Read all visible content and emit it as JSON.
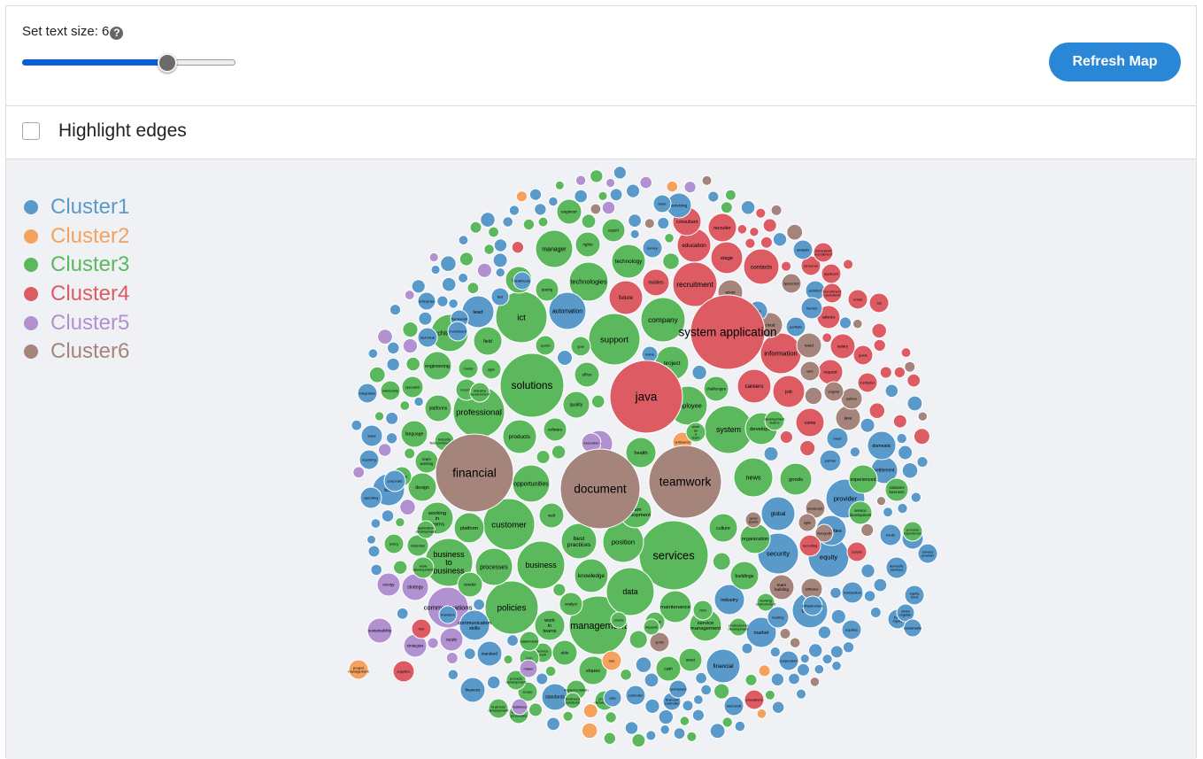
{
  "controls": {
    "text_size_label": "Set text size: 6",
    "help_icon": "question-circle-icon",
    "slider_value": 6,
    "slider_fraction": 0.68,
    "refresh_label": "Refresh Map",
    "highlight_edges_label": "Highlight edges",
    "highlight_edges_checked": false
  },
  "colors": {
    "accent": "#2a86d6",
    "slider_fill": "#0a5fd6",
    "map_background": "#f0f1f5"
  },
  "legend": [
    {
      "label": "Cluster1",
      "color": "#5a9acb"
    },
    {
      "label": "Cluster2",
      "color": "#f5a25e"
    },
    {
      "label": "Cluster3",
      "color": "#5cb85c"
    },
    {
      "label": "Cluster4",
      "color": "#dd5c64"
    },
    {
      "label": "Cluster5",
      "color": "#b191d0"
    },
    {
      "label": "Cluster6",
      "color": "#a5847b"
    }
  ],
  "bubbles": [
    {
      "label": "application",
      "cluster": 4
    },
    {
      "label": "teams",
      "cluster": 3
    },
    {
      "label": "developments",
      "cluster": 3
    },
    {
      "label": "collaboration",
      "cluster": 3
    },
    {
      "label": "development",
      "cluster": 3
    },
    {
      "label": "services",
      "cluster": 3
    },
    {
      "label": "solutions",
      "cluster": 3
    },
    {
      "label": "professional",
      "cluster": 3
    },
    {
      "label": "business to business",
      "cluster": 3
    },
    {
      "label": "business",
      "cluster": 3
    },
    {
      "label": "customer",
      "cluster": 3
    },
    {
      "label": "policies",
      "cluster": 3
    },
    {
      "label": "management",
      "cluster": 3
    },
    {
      "label": "data",
      "cluster": 3
    },
    {
      "label": "ict",
      "cluster": 3
    },
    {
      "label": "support",
      "cluster": 3
    },
    {
      "label": "company",
      "cluster": 3
    },
    {
      "label": "system",
      "cluster": 3
    },
    {
      "label": "recruitment",
      "cluster": 4
    },
    {
      "label": "information",
      "cluster": 4
    },
    {
      "label": "news",
      "cluster": 3
    },
    {
      "label": "opportunities",
      "cluster": 3
    },
    {
      "label": "position",
      "cluster": 3
    },
    {
      "label": "employee",
      "cluster": 3
    },
    {
      "label": "project",
      "cluster": 3
    },
    {
      "label": "careers",
      "cluster": 4
    },
    {
      "label": "job",
      "cluster": 4
    },
    {
      "label": "security",
      "cluster": 1
    },
    {
      "label": "equity",
      "cluster": 1
    },
    {
      "label": "global",
      "cluster": 1
    },
    {
      "label": "provider",
      "cluster": 1
    },
    {
      "label": "products",
      "cluster": 3
    },
    {
      "label": "health",
      "cluster": 3
    },
    {
      "label": "processes",
      "cluster": 3
    },
    {
      "label": "knowledge",
      "cluster": 3
    },
    {
      "label": "best practices",
      "cluster": 3
    },
    {
      "label": "team development",
      "cluster": 3
    },
    {
      "label": "quality",
      "cluster": 3
    },
    {
      "label": "contacts",
      "cluster": 4
    },
    {
      "label": "education",
      "cluster": 4
    },
    {
      "label": "manager",
      "cluster": 3
    },
    {
      "label": "technologies",
      "cluster": 3
    },
    {
      "label": "technology",
      "cluster": 3
    },
    {
      "label": "automation",
      "cluster": 1
    },
    {
      "label": "field",
      "cluster": 3
    },
    {
      "label": "lead",
      "cluster": 1
    },
    {
      "label": "architectures",
      "cluster": 3
    },
    {
      "label": "tool",
      "cluster": 1
    },
    {
      "label": "design",
      "cluster": 3
    },
    {
      "label": "working in teams",
      "cluster": 3
    },
    {
      "label": "platform",
      "cluster": 3
    },
    {
      "label": "well",
      "cluster": 3
    },
    {
      "label": "work in teams",
      "cluster": 3
    },
    {
      "label": "communications",
      "cluster": 5
    },
    {
      "label": "industry",
      "cluster": 1
    },
    {
      "label": "culture",
      "cluster": 3
    },
    {
      "label": "organization",
      "cluster": 3
    },
    {
      "label": "buildings",
      "cluster": 3
    },
    {
      "label": "maintenance",
      "cluster": 3
    },
    {
      "label": "service management",
      "cluster": 3
    },
    {
      "label": "goods",
      "cluster": 3
    },
    {
      "label": "developer",
      "cluster": 3
    },
    {
      "label": "capital",
      "cluster": 1
    },
    {
      "label": "market",
      "cluster": 1
    },
    {
      "label": "financial",
      "cluster": 1
    },
    {
      "label": "future",
      "cluster": 4
    },
    {
      "label": "stage",
      "cluster": 4
    },
    {
      "label": "recruiter",
      "cluster": 4
    },
    {
      "label": "securities",
      "cluster": 1
    },
    {
      "label": "settlement",
      "cluster": 1
    },
    {
      "label": "domestic",
      "cluster": 1
    },
    {
      "label": "strategy",
      "cluster": 5
    },
    {
      "label": "coms",
      "cluster": 4
    },
    {
      "label": "challenges",
      "cluster": 3
    },
    {
      "label": "office",
      "cluster": 3
    },
    {
      "label": "software",
      "cluster": 3
    },
    {
      "label": "platforms",
      "cluster": 3
    },
    {
      "label": "language",
      "cluster": 3
    },
    {
      "label": "engineering",
      "cluster": 3
    },
    {
      "label": "person",
      "cluster": 3
    },
    {
      "label": "testing",
      "cluster": 3
    },
    {
      "label": "rights",
      "cluster": 3
    },
    {
      "label": "expert",
      "cluster": 3
    },
    {
      "label": "engineer",
      "cluster": 3
    },
    {
      "label": "mobiles",
      "cluster": 4
    },
    {
      "label": "consultant",
      "cluster": 4
    },
    {
      "label": "azure",
      "cluster": 6
    },
    {
      "label": "cloud",
      "cluster": 6
    },
    {
      "label": "salaries",
      "cluster": 4
    },
    {
      "label": "salary",
      "cluster": 4
    },
    {
      "label": "request",
      "cluster": 4
    },
    {
      "label": "react",
      "cluster": 6
    },
    {
      "label": "java",
      "cluster": 6
    },
    {
      "label": "team building",
      "cluster": 6
    },
    {
      "label": "attitudes",
      "cluster": 6
    },
    {
      "label": "shares",
      "cluster": 3
    },
    {
      "label": "able",
      "cluster": 3
    },
    {
      "label": "cash",
      "cluster": 3
    },
    {
      "label": "asset",
      "cluster": 3
    },
    {
      "label": "standards",
      "cluster": 1
    },
    {
      "label": "finances",
      "cluster": 1
    },
    {
      "label": "standard",
      "cluster": 1
    },
    {
      "label": "communication skills",
      "cluster": 1
    },
    {
      "label": "vendor",
      "cluster": 3
    },
    {
      "label": "analyst",
      "cluster": 3
    },
    {
      "label": "sustainability",
      "cluster": 5
    },
    {
      "label": "energy",
      "cluster": 5
    },
    {
      "label": "supply",
      "cluster": 5
    },
    {
      "label": "strategies",
      "cluster": 5
    },
    {
      "label": "project management",
      "cluster": 2
    },
    {
      "label": "doe",
      "cluster": 2
    },
    {
      "label": "sports",
      "cluster": 3
    },
    {
      "label": "goal",
      "cluster": 3
    },
    {
      "label": "agile",
      "cluster": 3
    },
    {
      "label": "model",
      "cluster": 3
    },
    {
      "label": "records",
      "cluster": 3
    },
    {
      "label": "specialist",
      "cluster": 3
    },
    {
      "label": "ownership",
      "cluster": 3
    },
    {
      "label": "team working",
      "cluster": 3
    },
    {
      "label": "materials",
      "cluster": 3
    },
    {
      "label": "policy",
      "cluster": 3
    },
    {
      "label": "leading",
      "cluster": 1
    },
    {
      "label": "funds",
      "cluster": 1
    },
    {
      "label": "bonds",
      "cluster": 1
    },
    {
      "label": "transaction",
      "cluster": 1
    },
    {
      "label": "head",
      "cluster": 1
    },
    {
      "label": "partner",
      "cluster": 1
    },
    {
      "label": "cooperation",
      "cluster": 1
    },
    {
      "label": "operating",
      "cluster": 1
    },
    {
      "label": "sales",
      "cluster": 1
    },
    {
      "label": "reporting",
      "cluster": 1
    },
    {
      "label": "integration",
      "cluster": 1
    },
    {
      "label": "technical",
      "cluster": 1
    },
    {
      "label": "enterprise",
      "cluster": 1
    },
    {
      "label": "framework",
      "cluster": 1
    },
    {
      "label": "user",
      "cluster": 1
    },
    {
      "label": "typescript",
      "cluster": 6
    },
    {
      "label": "personal",
      "cluster": 4
    },
    {
      "label": "applicant",
      "cluster": 4
    },
    {
      "label": "email",
      "cluster": 4
    },
    {
      "label": "guide",
      "cluster": 4
    },
    {
      "label": "institution",
      "cluster": 4
    },
    {
      "label": "sql",
      "cluster": 4
    },
    {
      "label": "python",
      "cluster": 6
    },
    {
      "label": "angular",
      "cluster": 6
    },
    {
      "label": "scripts",
      "cluster": 4
    },
    {
      "label": "mongodb",
      "cluster": 6
    },
    {
      "label": "javascript",
      "cluster": 6
    },
    {
      "label": "agile",
      "cluster": 6
    },
    {
      "label": "web",
      "cluster": 6
    },
    {
      "label": "good sports",
      "cluster": 6
    },
    {
      "label": "sprits",
      "cluster": 6
    },
    {
      "label": "interest",
      "cluster": 3
    },
    {
      "label": "html",
      "cluster": 3
    },
    {
      "label": "impacts",
      "cluster": 3
    },
    {
      "label": "phone",
      "cluster": 3
    },
    {
      "label": "service work",
      "cluster": 3
    },
    {
      "label": "turn",
      "cluster": 3
    },
    {
      "label": "stakeholder",
      "cluster": 3
    },
    {
      "label": "scope",
      "cluster": 3
    },
    {
      "label": "process development",
      "cluster": 3
    },
    {
      "label": "product development",
      "cluster": 3
    },
    {
      "label": "implementation",
      "cluster": 3
    },
    {
      "label": "business development",
      "cluster": 3
    },
    {
      "label": "business processes",
      "cluster": 3
    },
    {
      "label": "business solutions",
      "cluster": 3
    },
    {
      "label": "sale",
      "cluster": 1
    },
    {
      "label": "controller",
      "cluster": 1
    },
    {
      "label": "financial controller",
      "cluster": 1
    },
    {
      "label": "permanent",
      "cluster": 1
    },
    {
      "label": "microsoft",
      "cluster": 1
    },
    {
      "label": "portfolio",
      "cluster": 1
    },
    {
      "label": "home",
      "cluster": 1
    },
    {
      "label": "survey",
      "cluster": 1
    },
    {
      "label": "healthcare",
      "cluster": 1
    },
    {
      "label": "test",
      "cluster": 1
    },
    {
      "label": "transfers",
      "cluster": 1
    },
    {
      "label": "supplies",
      "cluster": 4
    },
    {
      "label": "first",
      "cluster": 4
    },
    {
      "label": "maker",
      "cluster": 5
    },
    {
      "label": "resilience",
      "cluster": 5
    },
    {
      "label": "tilo",
      "cluster": 5
    },
    {
      "label": "execution",
      "cluster": 5
    },
    {
      "label": "outsource",
      "cluster": 2
    },
    {
      "label": "work as a team",
      "cluster": 3
    },
    {
      "label": "development teams",
      "cluster": 3
    },
    {
      "label": "industry Government",
      "cluster": 3
    },
    {
      "label": "Industry Telecommunication",
      "cluster": 3
    },
    {
      "label": "analyst",
      "cluster": 3
    },
    {
      "label": "application development",
      "cluster": 3
    },
    {
      "label": "working environment",
      "cluster": 3
    },
    {
      "label": "professional development",
      "cluster": 3
    },
    {
      "label": "work development",
      "cluster": 3
    },
    {
      "label": "experienced",
      "cluster": 3
    },
    {
      "label": "service development",
      "cluster": 3
    },
    {
      "label": "solutions business",
      "cluster": 3
    },
    {
      "label": "process experience",
      "cluster": 3
    },
    {
      "label": "service provider",
      "cluster": 1
    },
    {
      "label": "domestic services",
      "cluster": 1
    },
    {
      "label": "equities",
      "cluster": 1
    },
    {
      "label": "fund equity",
      "cluster": 1
    },
    {
      "label": "equity fund",
      "cluster": 1
    },
    {
      "label": "share register",
      "cluster": 1
    },
    {
      "label": "sustainable",
      "cluster": 1
    },
    {
      "label": "corporate",
      "cluster": 1
    },
    {
      "label": "infrastructure",
      "cluster": 1
    },
    {
      "label": "investment",
      "cluster": 1
    },
    {
      "label": "servicing",
      "cluster": 1
    },
    {
      "label": "trade",
      "cluster": 1
    },
    {
      "label": "architect",
      "cluster": 1
    },
    {
      "label": "analysis",
      "cluster": 1
    },
    {
      "label": "mentor",
      "cluster": 1
    },
    {
      "label": "recruitment consultant",
      "cluster": 4
    },
    {
      "label": "consultant recruitment",
      "cluster": 4
    },
    {
      "label": "recruiting",
      "cluster": 4
    },
    {
      "label": "educations",
      "cluster": 4
    },
    {
      "label": "system application",
      "cluster": 4
    },
    {
      "label": "java",
      "cluster": 4
    },
    {
      "label": "document",
      "cluster": 6
    },
    {
      "label": "teamwork",
      "cluster": 6
    },
    {
      "label": "financial",
      "cluster": 6
    }
  ]
}
